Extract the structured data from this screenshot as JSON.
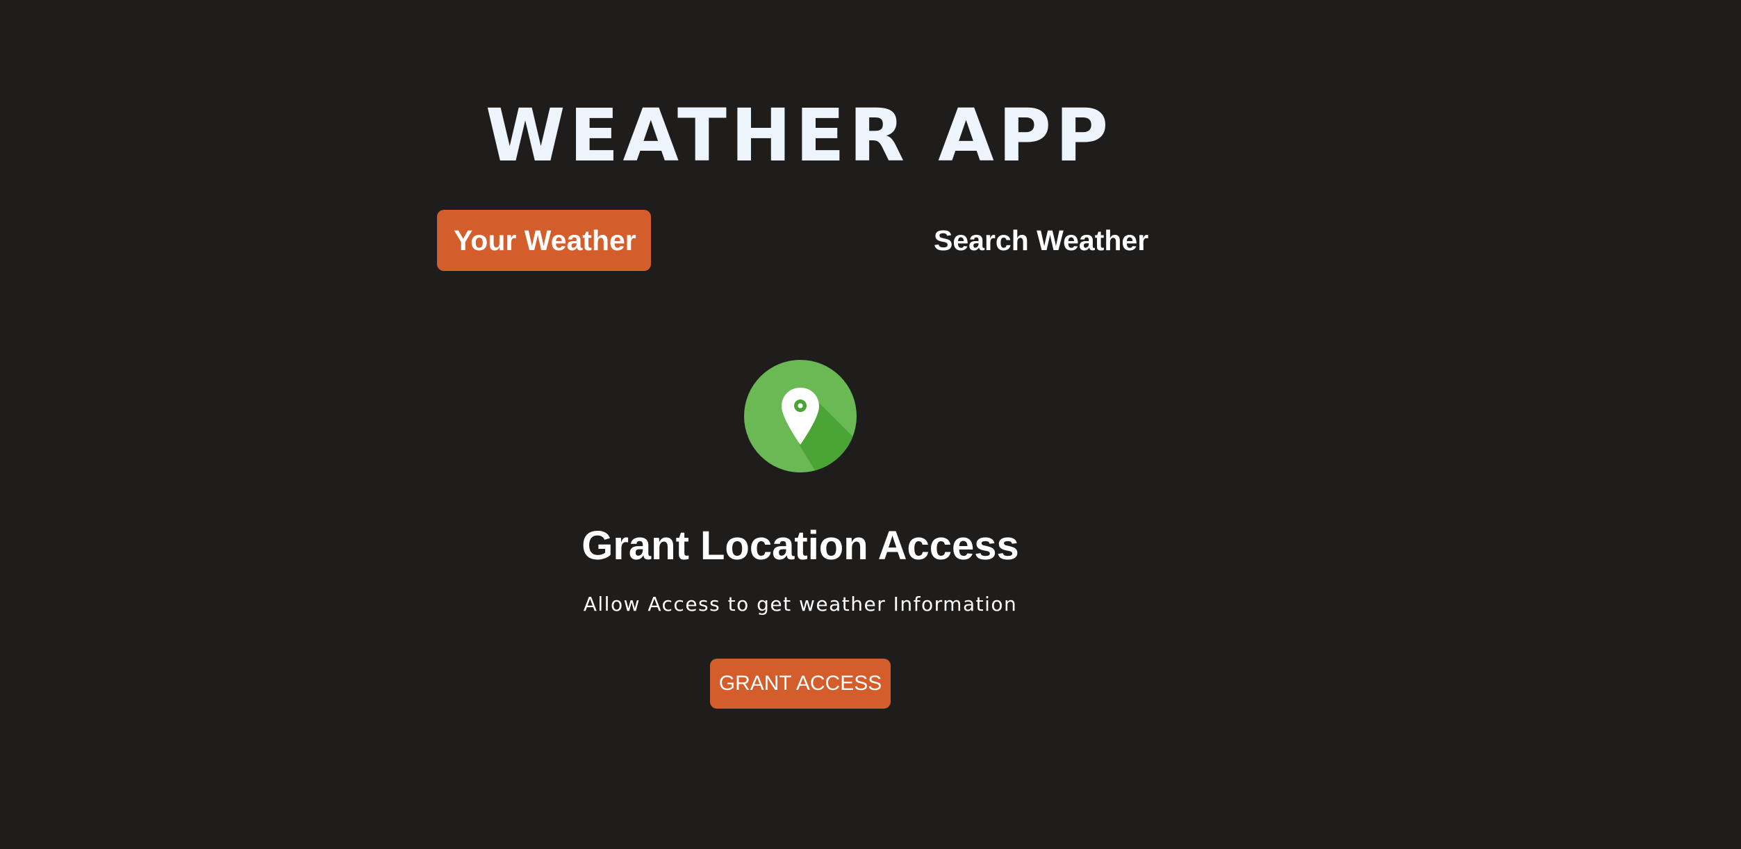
{
  "app": {
    "title": "WEATHER APP"
  },
  "tabs": [
    {
      "label": "Your Weather",
      "active": true
    },
    {
      "label": "Search Weather",
      "active": false
    }
  ],
  "grant": {
    "icon": "location-pin-icon",
    "heading": "Grant Location Access",
    "subtext": "Allow Access to get weather Information",
    "button_label": "GRANT ACCESS"
  },
  "colors": {
    "background": "#1f1d1c",
    "accent": "#d45d2c",
    "icon_green": "#6ab955",
    "icon_green_shadow": "#4aa534",
    "text": "#ffffff"
  }
}
